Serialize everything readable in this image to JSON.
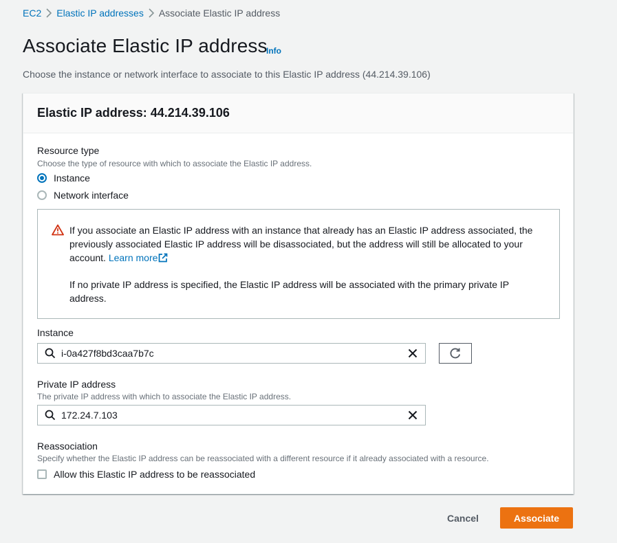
{
  "breadcrumb": {
    "items": [
      {
        "label": "EC2"
      },
      {
        "label": "Elastic IP addresses"
      },
      {
        "label": "Associate Elastic IP address"
      }
    ]
  },
  "header": {
    "title": "Associate Elastic IP address",
    "info_label": "Info",
    "description": "Choose the instance or network interface to associate to this Elastic IP address (44.214.39.106)"
  },
  "panel": {
    "title": "Elastic IP address: 44.214.39.106",
    "resource_type": {
      "label": "Resource type",
      "description": "Choose the type of resource with which to associate the Elastic IP address.",
      "options": [
        {
          "label": "Instance",
          "selected": true
        },
        {
          "label": "Network interface",
          "selected": false
        }
      ]
    },
    "alert": {
      "text_main": "If you associate an Elastic IP address with an instance that already has an Elastic IP address associated, the previously associated Elastic IP address will be disassociated, but the address will still be allocated to your account. ",
      "learn_more": "Learn more",
      "text_secondary": "If no private IP address is specified, the Elastic IP address will be associated with the primary private IP address."
    },
    "instance": {
      "label": "Instance",
      "value": "i-0a427f8bd3caa7b7c"
    },
    "private_ip": {
      "label": "Private IP address",
      "description": "The private IP address with which to associate the Elastic IP address.",
      "value": "172.24.7.103"
    },
    "reassociation": {
      "label": "Reassociation",
      "description": "Specify whether the Elastic IP address can be reassociated with a different resource if it already associated with a resource.",
      "checkbox_label": "Allow this Elastic IP address to be reassociated",
      "checked": false
    }
  },
  "footer": {
    "cancel_label": "Cancel",
    "submit_label": "Associate"
  },
  "colors": {
    "link": "#0073bb",
    "primary_button": "#ec7211",
    "warning": "#d13212",
    "background": "#f2f3f3"
  }
}
